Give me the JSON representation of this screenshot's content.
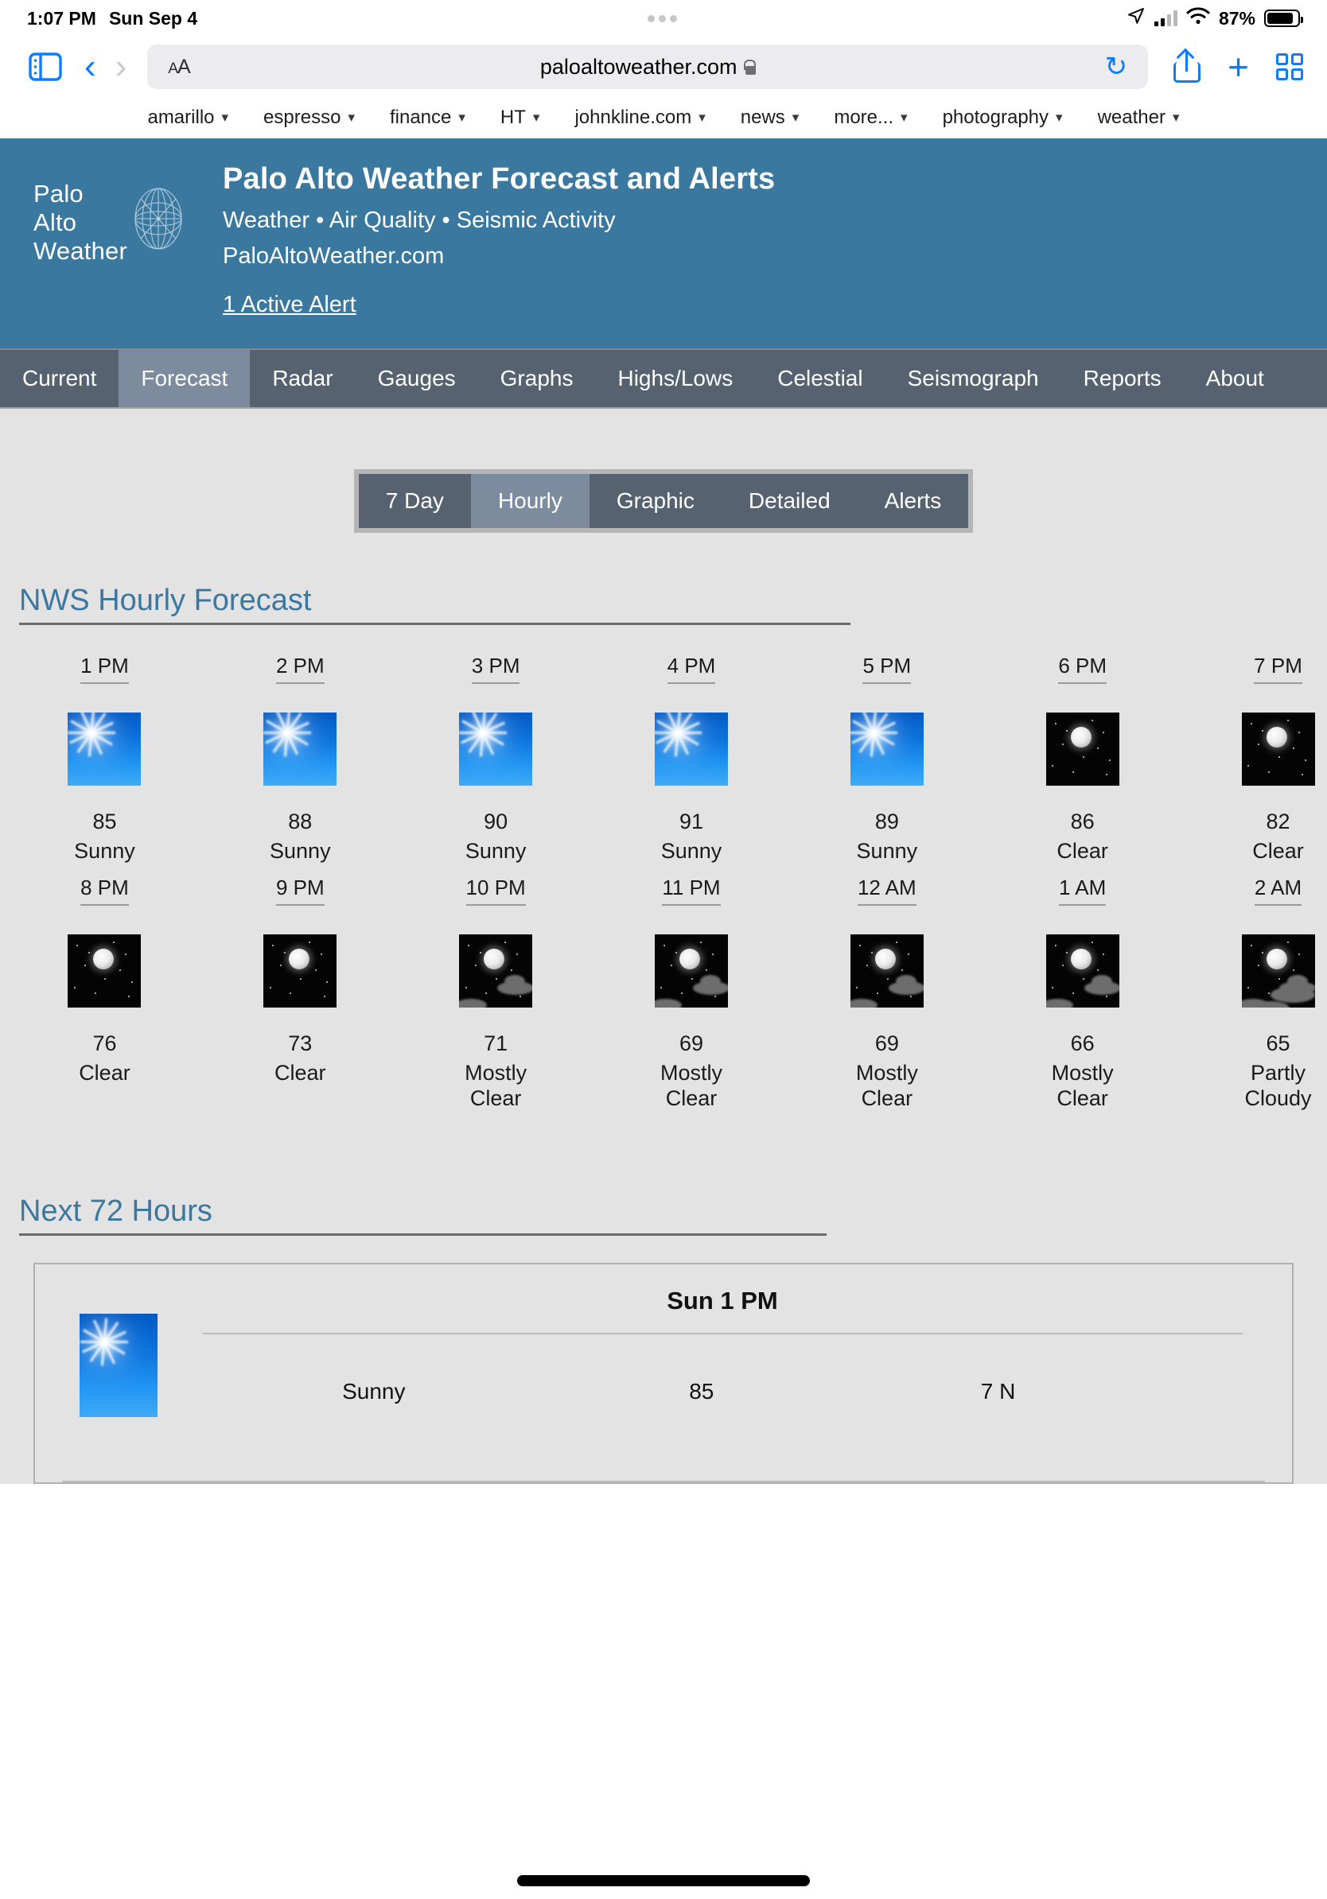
{
  "status_bar": {
    "time": "1:07 PM",
    "date": "Sun Sep 4",
    "battery_percent": "87%",
    "location_icon": "location-arrow-icon",
    "wifi_icon": "wifi-icon",
    "cellular_icon": "signal-bars-icon",
    "battery_icon": "battery-icon"
  },
  "browser": {
    "sidebar_icon": "sidebar-toggle-icon",
    "back_icon": "back-chevron-icon",
    "forward_icon": "forward-chevron-icon",
    "text_size_label": "AA",
    "url": "paloaltoweather.com",
    "lock_icon": "lock-icon",
    "reload_icon": "reload-icon",
    "share_icon": "share-icon",
    "new_tab_icon": "plus-icon",
    "tabs_icon": "tab-overview-icon"
  },
  "bookmarks": [
    {
      "label": "amarillo"
    },
    {
      "label": "espresso"
    },
    {
      "label": "finance"
    },
    {
      "label": "HT"
    },
    {
      "label": "johnkline.com"
    },
    {
      "label": "news"
    },
    {
      "label": "more..."
    },
    {
      "label": "photography"
    },
    {
      "label": "weather"
    }
  ],
  "site_header": {
    "logo_lines": [
      "Palo",
      "Alto",
      "Weather"
    ],
    "logo_icon": "globe-icon",
    "title": "Palo Alto Weather Forecast and Alerts",
    "subtitle": "Weather • Air Quality • Seismic Activity",
    "url": "PaloAltoWeather.com",
    "alert_link": "1 Active Alert",
    "background_color": "#3a78a0"
  },
  "nav": {
    "items": [
      {
        "label": "Current",
        "active": false
      },
      {
        "label": "Forecast",
        "active": true
      },
      {
        "label": "Radar",
        "active": false
      },
      {
        "label": "Gauges",
        "active": false
      },
      {
        "label": "Graphs",
        "active": false
      },
      {
        "label": "Highs/Lows",
        "active": false
      },
      {
        "label": "Celestial",
        "active": false
      },
      {
        "label": "Seismograph",
        "active": false
      },
      {
        "label": "Reports",
        "active": false
      },
      {
        "label": "About",
        "active": false
      }
    ],
    "background_color": "#566270",
    "active_color": "#7c8b9d"
  },
  "segmented": {
    "items": [
      {
        "label": "7 Day",
        "active": false
      },
      {
        "label": "Hourly",
        "active": true
      },
      {
        "label": "Graphic",
        "active": false
      },
      {
        "label": "Detailed",
        "active": false
      },
      {
        "label": "Alerts",
        "active": false
      }
    ]
  },
  "hourly_section": {
    "title": "NWS Hourly Forecast",
    "title_color": "#3a78a0",
    "hours": [
      {
        "time": "1 PM",
        "temp": "85",
        "desc": "Sunny",
        "icon": "sunny-day-icon"
      },
      {
        "time": "2 PM",
        "temp": "88",
        "desc": "Sunny",
        "icon": "sunny-day-icon"
      },
      {
        "time": "3 PM",
        "temp": "90",
        "desc": "Sunny",
        "icon": "sunny-day-icon"
      },
      {
        "time": "4 PM",
        "temp": "91",
        "desc": "Sunny",
        "icon": "sunny-day-icon"
      },
      {
        "time": "5 PM",
        "temp": "89",
        "desc": "Sunny",
        "icon": "sunny-day-icon"
      },
      {
        "time": "6 PM",
        "temp": "86",
        "desc": "Clear",
        "icon": "clear-night-icon"
      },
      {
        "time": "7 PM",
        "temp": "82",
        "desc": "Clear",
        "icon": "clear-night-icon"
      },
      {
        "time": "8 PM",
        "temp": "76",
        "desc": "Clear",
        "icon": "clear-night-icon"
      },
      {
        "time": "9 PM",
        "temp": "73",
        "desc": "Clear",
        "icon": "clear-night-icon"
      },
      {
        "time": "10 PM",
        "temp": "71",
        "desc": "Mostly Clear",
        "icon": "mostly-clear-night-icon"
      },
      {
        "time": "11 PM",
        "temp": "69",
        "desc": "Mostly Clear",
        "icon": "mostly-clear-night-icon"
      },
      {
        "time": "12 AM",
        "temp": "69",
        "desc": "Mostly Clear",
        "icon": "mostly-clear-night-icon"
      },
      {
        "time": "1 AM",
        "temp": "66",
        "desc": "Mostly Clear",
        "icon": "mostly-clear-night-icon"
      },
      {
        "time": "2 AM",
        "temp": "65",
        "desc": "Partly Cloudy",
        "icon": "partly-cloudy-night-icon"
      }
    ]
  },
  "next72": {
    "title": "Next 72 Hours",
    "title_color": "#3a78a0",
    "rows": [
      {
        "heading": "Sun 1 PM",
        "icon": "sunny-day-icon",
        "condition": "Sunny",
        "temperature": "85",
        "wind": "7 N"
      }
    ]
  }
}
